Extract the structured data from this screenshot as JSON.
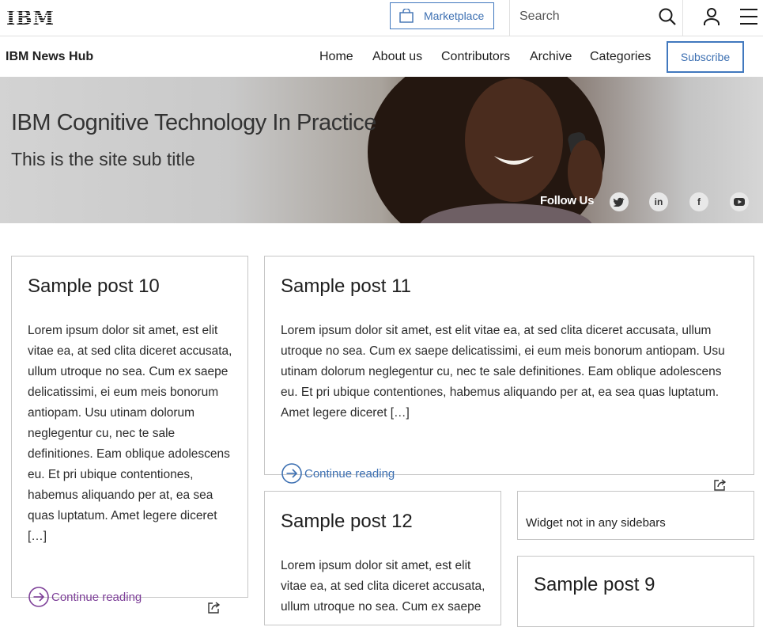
{
  "brand": {
    "logo": "IBM"
  },
  "masthead": {
    "marketplace_label": "Marketplace",
    "search_placeholder": "Search"
  },
  "subnav": {
    "site_name": "IBM News Hub",
    "items": [
      "Home",
      "About us",
      "Contributors",
      "Archive",
      "Categories"
    ],
    "subscribe_label": "Subscribe"
  },
  "hero": {
    "title": "IBM Cognitive Technology In Practice",
    "subtitle": "This is the site sub title",
    "follow_label": "Follow Us",
    "social_icons": [
      "twitter-icon",
      "linkedin-icon",
      "facebook-icon",
      "youtube-icon"
    ]
  },
  "posts": [
    {
      "title": "Sample post 10",
      "excerpt": "Lorem ipsum dolor sit amet, est elit vitae ea, at sed clita diceret accusata, ullum utroque no sea. Cum ex saepe delicatissimi, ei eum meis bonorum antiopam. Usu utinam dolorum neglegentur cu, nec te sale definitiones. Eam oblique adolescens eu. Et pri ubique contentiones, habemus aliquando per at, ea sea quas luptatum. Amet legere diceret […]",
      "continue_label": "Continue reading"
    },
    {
      "title": "Sample post 11",
      "excerpt": "Lorem ipsum dolor sit amet, est elit vitae ea, at sed clita diceret accusata, ullum utroque no sea. Cum ex saepe delicatissimi, ei eum meis bonorum antiopam. Usu utinam dolorum neglegentur cu, nec te sale definitiones. Eam oblique adolescens eu. Et pri ubique contentiones, habemus aliquando per at, ea sea quas luptatum. Amet legere diceret […]",
      "continue_label": "Continue reading"
    },
    {
      "title": "Sample post 12",
      "excerpt": "Lorem ipsum dolor sit amet, est elit vitae ea, at sed clita diceret accusata, ullum utroque no sea. Cum ex saepe"
    },
    {
      "title": "Sample post 9"
    }
  ],
  "widget": {
    "text": "Widget not in any sidebars"
  },
  "colors": {
    "accent": "#4178be",
    "link_visited": "#7d3f98",
    "link": "#3d70b2",
    "border": "#c6c6c6"
  }
}
